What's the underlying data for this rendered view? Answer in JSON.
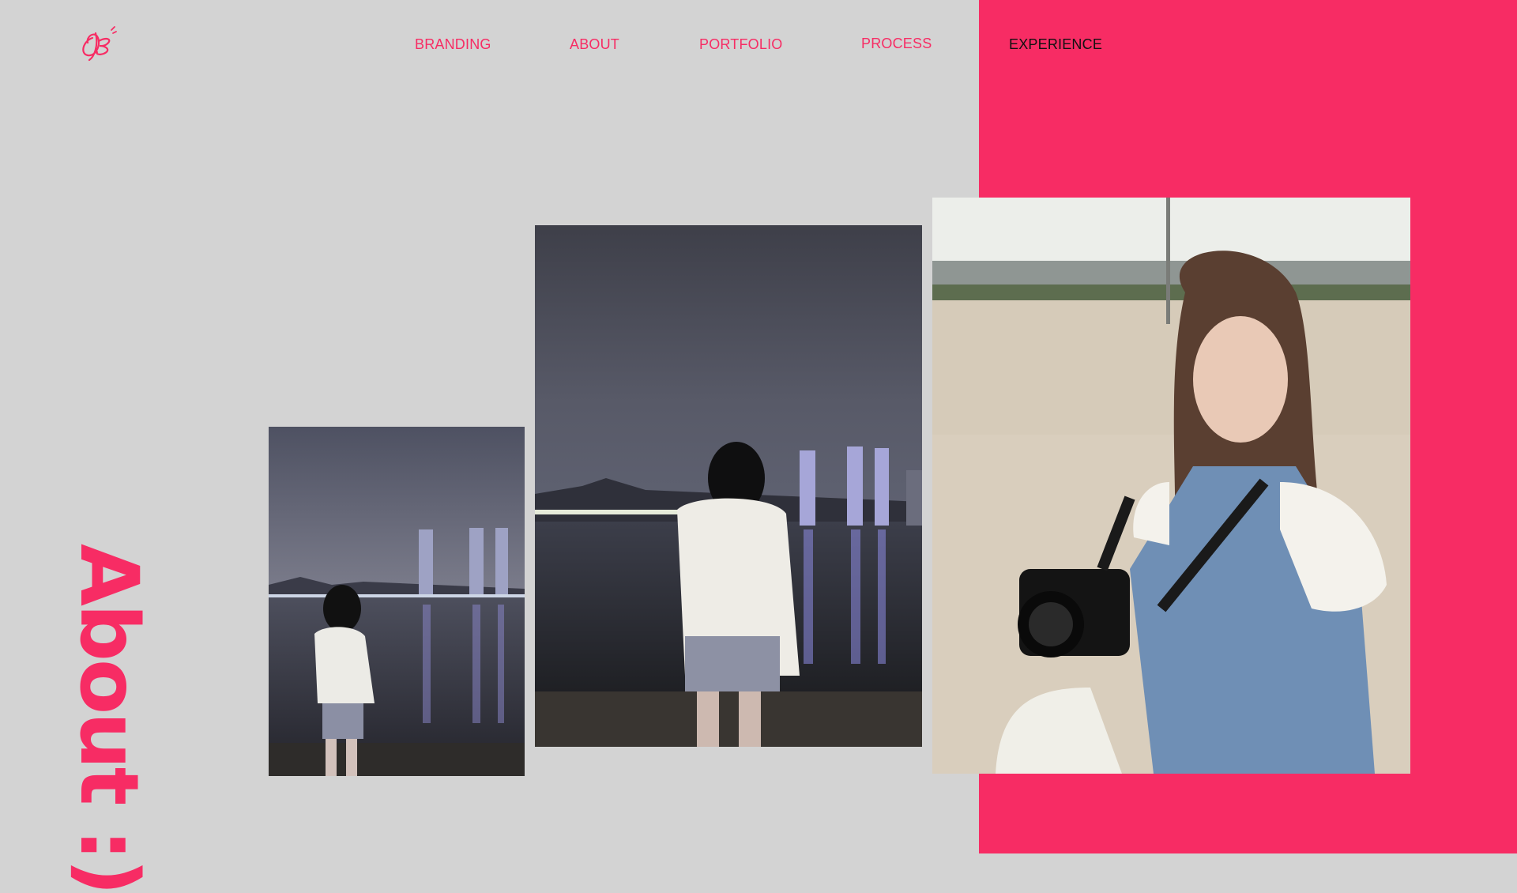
{
  "nav": {
    "items": [
      {
        "label": "BRANDING"
      },
      {
        "label": "ABOUT"
      },
      {
        "label": "PORTFOLIO"
      },
      {
        "label": "PROCESS"
      },
      {
        "label": "EXPERIENCE",
        "active": true
      }
    ]
  },
  "heading": {
    "text": "About :)"
  },
  "colors": {
    "accent": "#f72c64",
    "background": "#d3d3d3",
    "active_nav": "#111111"
  },
  "icons": {
    "logo": "signature-logo-icon"
  }
}
